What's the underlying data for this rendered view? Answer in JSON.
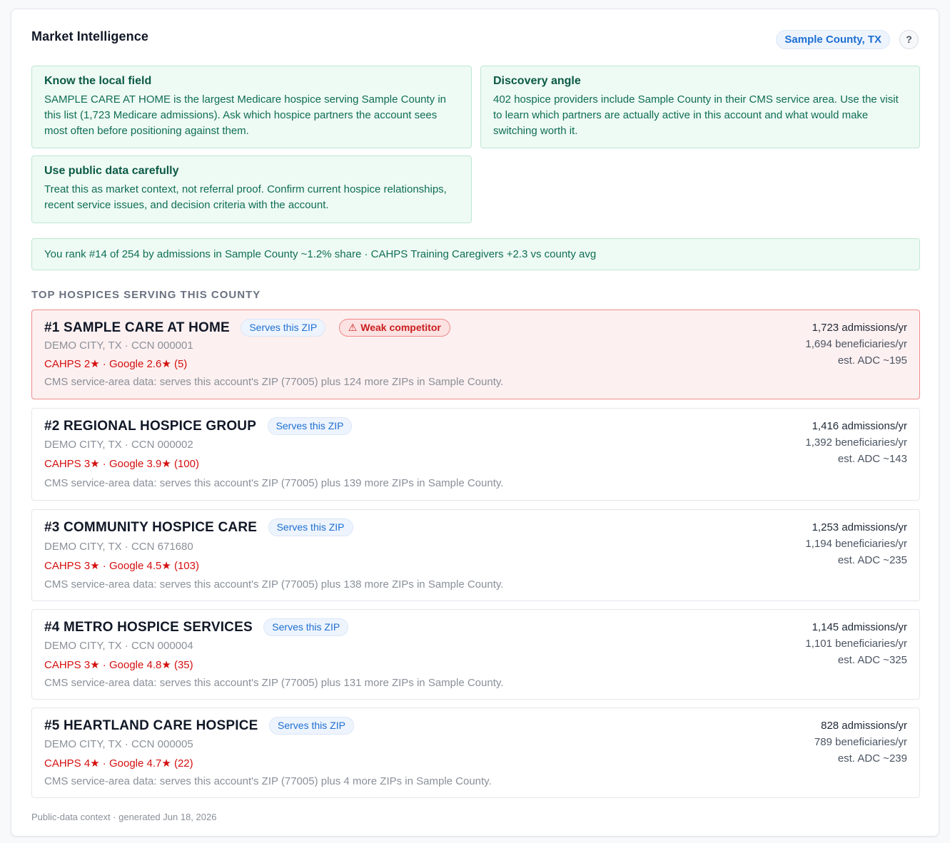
{
  "header": {
    "title": "Market Intelligence",
    "county": "Sample County, TX",
    "help": "?"
  },
  "insights": [
    {
      "heading": "Know the local field",
      "body": "SAMPLE CARE AT HOME is the largest Medicare hospice serving Sample County in this list (1,723 Medicare admissions). Ask which hospice partners the account sees most often before positioning against them."
    },
    {
      "heading": "Discovery angle",
      "body": "402 hospice providers include Sample County in their CMS service area. Use the visit to learn which partners are actually active in this account and what would make switching worth it."
    },
    {
      "heading": "Use public data carefully",
      "body": "Treat this as market context, not referral proof. Confirm current hospice relationships, recent service issues, and decision criteria with the account."
    }
  ],
  "rank_summary": "You rank #14 of 254 by admissions in Sample County ~1.2% share · CAHPS Training Caregivers +2.3 vs county avg",
  "section_title": "TOP HOSPICES SERVING THIS COUNTY",
  "hospices": [
    {
      "name": "#1 SAMPLE CARE AT HOME",
      "zip_badge": "Serves this ZIP",
      "warning_badge": "Weak competitor",
      "location": "DEMO CITY, TX · CCN 000001",
      "ratings": "CAHPS 2★  ·  Google 2.6★ (5)",
      "note": "CMS service-area data: serves this account's ZIP (77005) plus 124 more ZIPs in Sample County.",
      "admissions": "1,723 admissions/yr",
      "beneficiaries": "1,694 beneficiaries/yr",
      "adc": "est. ADC ~195"
    },
    {
      "name": "#2 REGIONAL HOSPICE GROUP",
      "zip_badge": "Serves this ZIP",
      "location": "DEMO CITY, TX · CCN 000002",
      "ratings": "CAHPS 3★  ·  Google 3.9★ (100)",
      "note": "CMS service-area data: serves this account's ZIP (77005) plus 139 more ZIPs in Sample County.",
      "admissions": "1,416 admissions/yr",
      "beneficiaries": "1,392 beneficiaries/yr",
      "adc": "est. ADC ~143"
    },
    {
      "name": "#3 COMMUNITY HOSPICE CARE",
      "zip_badge": "Serves this ZIP",
      "location": "DEMO CITY, TX · CCN 671680",
      "ratings": "CAHPS 3★  ·  Google 4.5★ (103)",
      "note": "CMS service-area data: serves this account's ZIP (77005) plus 138 more ZIPs in Sample County.",
      "admissions": "1,253 admissions/yr",
      "beneficiaries": "1,194 beneficiaries/yr",
      "adc": "est. ADC ~235"
    },
    {
      "name": "#4 METRO HOSPICE SERVICES",
      "zip_badge": "Serves this ZIP",
      "location": "DEMO CITY, TX · CCN 000004",
      "ratings": "CAHPS 3★  ·  Google 4.8★ (35)",
      "note": "CMS service-area data: serves this account's ZIP (77005) plus 131 more ZIPs in Sample County.",
      "admissions": "1,145 admissions/yr",
      "beneficiaries": "1,101 beneficiaries/yr",
      "adc": "est. ADC ~325"
    },
    {
      "name": "#5 HEARTLAND CARE HOSPICE",
      "zip_badge": "Serves this ZIP",
      "location": "DEMO CITY, TX · CCN 000005",
      "ratings": "CAHPS 4★  ·  Google 4.7★ (22)",
      "note": "CMS service-area data: serves this account's ZIP (77005) plus 4 more ZIPs in Sample County.",
      "admissions": "828 admissions/yr",
      "beneficiaries": "789 beneficiaries/yr",
      "adc": "est. ADC ~239"
    }
  ],
  "footer": "Public-data context · generated Jun 18, 2026"
}
